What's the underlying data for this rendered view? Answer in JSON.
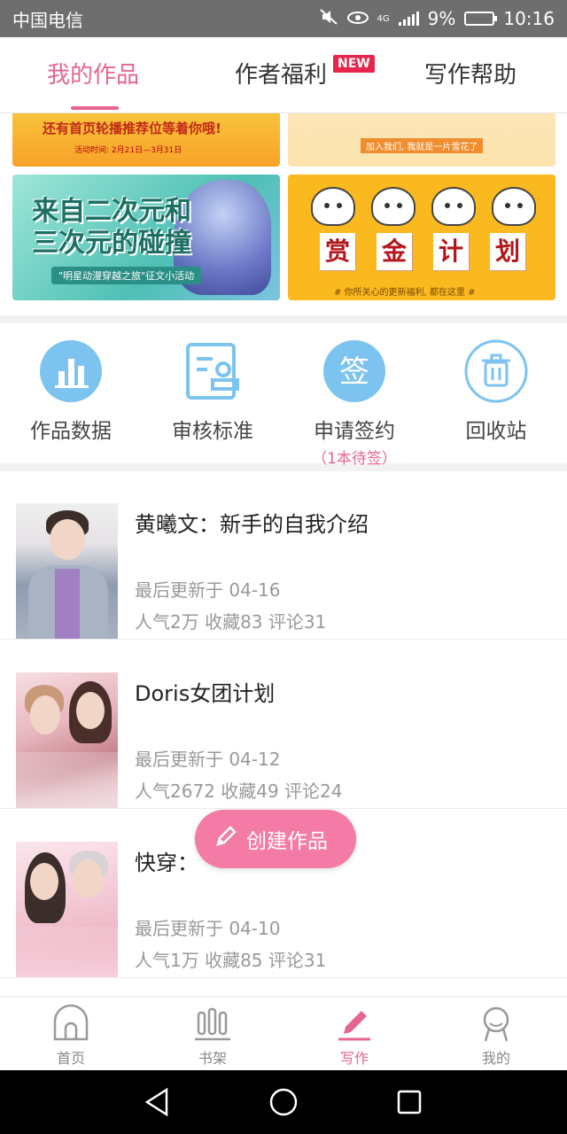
{
  "status_bar": {
    "carrier": "中国电信",
    "network": "4G",
    "battery": "9%",
    "time": "10:16"
  },
  "tabs": [
    {
      "label": "我的作品",
      "active": true
    },
    {
      "label": "作者福利",
      "badge": "NEW"
    },
    {
      "label": "写作帮助"
    }
  ],
  "banners": [
    {
      "text": "还有首页轮播推荐位等着你哦!",
      "sub": "活动时间: 2月21日—3月31日"
    },
    {
      "text": "加入我们, 我就是一片雪花了"
    },
    {
      "text": "来自二次元和三次元的碰撞",
      "sub": "\"明星动漫穿越之旅\"征文小活动"
    },
    {
      "chars": [
        "赏",
        "金",
        "计",
        "划"
      ],
      "sub": "# 你所关心的更新福利, 都在这里 #"
    }
  ],
  "actions": [
    {
      "label": "作品数据",
      "icon": "bar-chart-icon"
    },
    {
      "label": "审核标准",
      "icon": "review-document-icon"
    },
    {
      "label": "申请签约",
      "icon": "sign-icon",
      "sub": "（1本待签）"
    },
    {
      "label": "回收站",
      "icon": "trash-icon"
    }
  ],
  "works": [
    {
      "title": "黄曦文：新手的自我介绍",
      "updated": "最后更新于 04-16",
      "stats": "人气2万  收藏83  评论31"
    },
    {
      "title": "Doris女团计划",
      "updated": "最后更新于 04-12",
      "stats": "人气2672  收藏49  评论24"
    },
    {
      "title": "快穿：",
      "updated": "最后更新于 04-10",
      "stats": "人气1万  收藏85  评论31"
    }
  ],
  "fab": {
    "label": "创建作品",
    "icon": "pencil-icon"
  },
  "bottom_nav": [
    {
      "label": "首页",
      "icon": "home-icon"
    },
    {
      "label": "书架",
      "icon": "bookshelf-icon"
    },
    {
      "label": "写作",
      "icon": "pen-icon",
      "active": true
    },
    {
      "label": "我的",
      "icon": "profile-icon"
    }
  ],
  "colors": {
    "accent": "#e5668e",
    "fab": "#f37ba6",
    "icon_blue": "#7cc4ef"
  }
}
